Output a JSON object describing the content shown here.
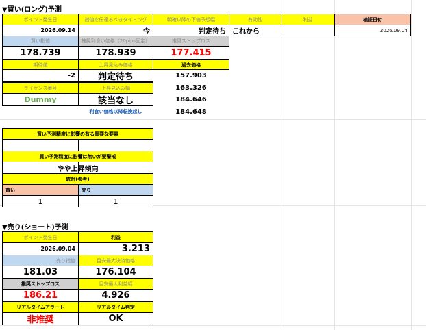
{
  "buy": {
    "title": "▼買い(ロング)予測",
    "h_date": "ポイント発生日",
    "h_notify": "指値を伝達るべきタイミング",
    "h_lower": "明確以降の下値予想幅",
    "h_valid": "有効性",
    "h_profit": "利益",
    "h_verify": "検証日付",
    "date": "2026.09.14",
    "notify": "今",
    "lower": "判定待ち",
    "valid": "これから",
    "verify_date": "2026.09.14",
    "h_buy_limit": "買い指値",
    "h_take_profit": "推奨利食い価格（20pips固定）",
    "h_stop": "推奨ストップロス",
    "buy_limit": "178.739",
    "take_profit": "178.939",
    "stop": "177.415",
    "h_mid": "期待値",
    "h_up": "上昇見込み価格",
    "h_hist": "過去価格",
    "mid": "-2",
    "up": "判定待ち",
    "hist1": "157.903",
    "h_license": "ライセンス番号",
    "h_up2": "上昇見込み幅",
    "hist2": "163.326",
    "license": "Dummy",
    "up2": "該当なし",
    "hist3": "184.646",
    "note": "利食い価格以降転換起し",
    "hist4": "184.648"
  },
  "impact": {
    "h1": "買い予測精度に影響の有る重要な要素",
    "v1": "",
    "h2": "買い予測精度に影響は無いが要警戒",
    "v2": "やや上昇傾向",
    "h3": "統計(参考)",
    "h_buy": "買い",
    "h_sell": "売り",
    "buy": "1",
    "sell": "1"
  },
  "sell": {
    "title": "▼売り(ショート)予測",
    "h_date": "ポイント発生日",
    "h_profit": "利益",
    "date": "2026.09.04",
    "profit": "3.213",
    "h_sell_limit": "売り指値",
    "h_target": "目安最大決済価格",
    "sell_limit": "181.03",
    "target": "176.104",
    "h_stop": "推奨ストップロス",
    "h_max_profit": "目安最大利益幅",
    "stop": "186.21",
    "max_profit": "4.926",
    "h_alert": "リアルタイムアラート",
    "h_judge": "リアルタイム判定",
    "alert": "非推奨",
    "judge": "OK"
  }
}
